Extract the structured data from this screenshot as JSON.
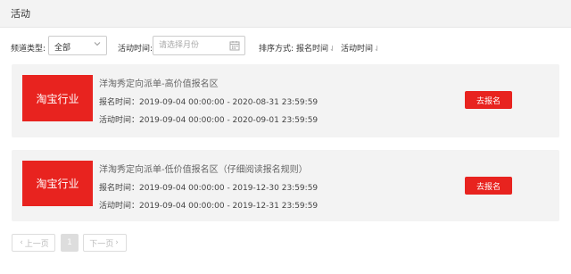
{
  "header": {
    "title": "活动"
  },
  "filters": {
    "channel_label": "频道类型:",
    "channel_value": "全部",
    "time_label": "活动时间:",
    "time_placeholder": "请选择月份",
    "sort_label": "排序方式:",
    "sort_options": [
      {
        "label": "报名时间",
        "arrow": "⇃"
      },
      {
        "label": "活动时间",
        "arrow": "⇃"
      }
    ]
  },
  "activities": [
    {
      "badge": "淘宝行业",
      "name": "洋淘秀定向派单-高价值报名区",
      "signup_period": "报名时间：2019-09-04 00:00:00 - 2020-08-31 23:59:59",
      "activity_period": "活动时间：2019-09-04 00:00:00 - 2020-09-01 23:59:59",
      "button_label": "去报名"
    },
    {
      "badge": "淘宝行业",
      "name": "洋淘秀定向派单-低价值报名区（仔细阅读报名规则）",
      "signup_period": "报名时间：2019-09-04 00:00:00 - 2019-12-30 23:59:59",
      "activity_period": "活动时间：2019-09-04 00:00:00 - 2019-12-31 23:59:59",
      "button_label": "去报名"
    }
  ],
  "pagination": {
    "prev_label": "上一页",
    "current_page": "1",
    "next_label": "下一页"
  },
  "colors": {
    "accent": "#e8231f",
    "card_bg": "#f3f3f3",
    "header_bg": "#f3f3f3"
  }
}
